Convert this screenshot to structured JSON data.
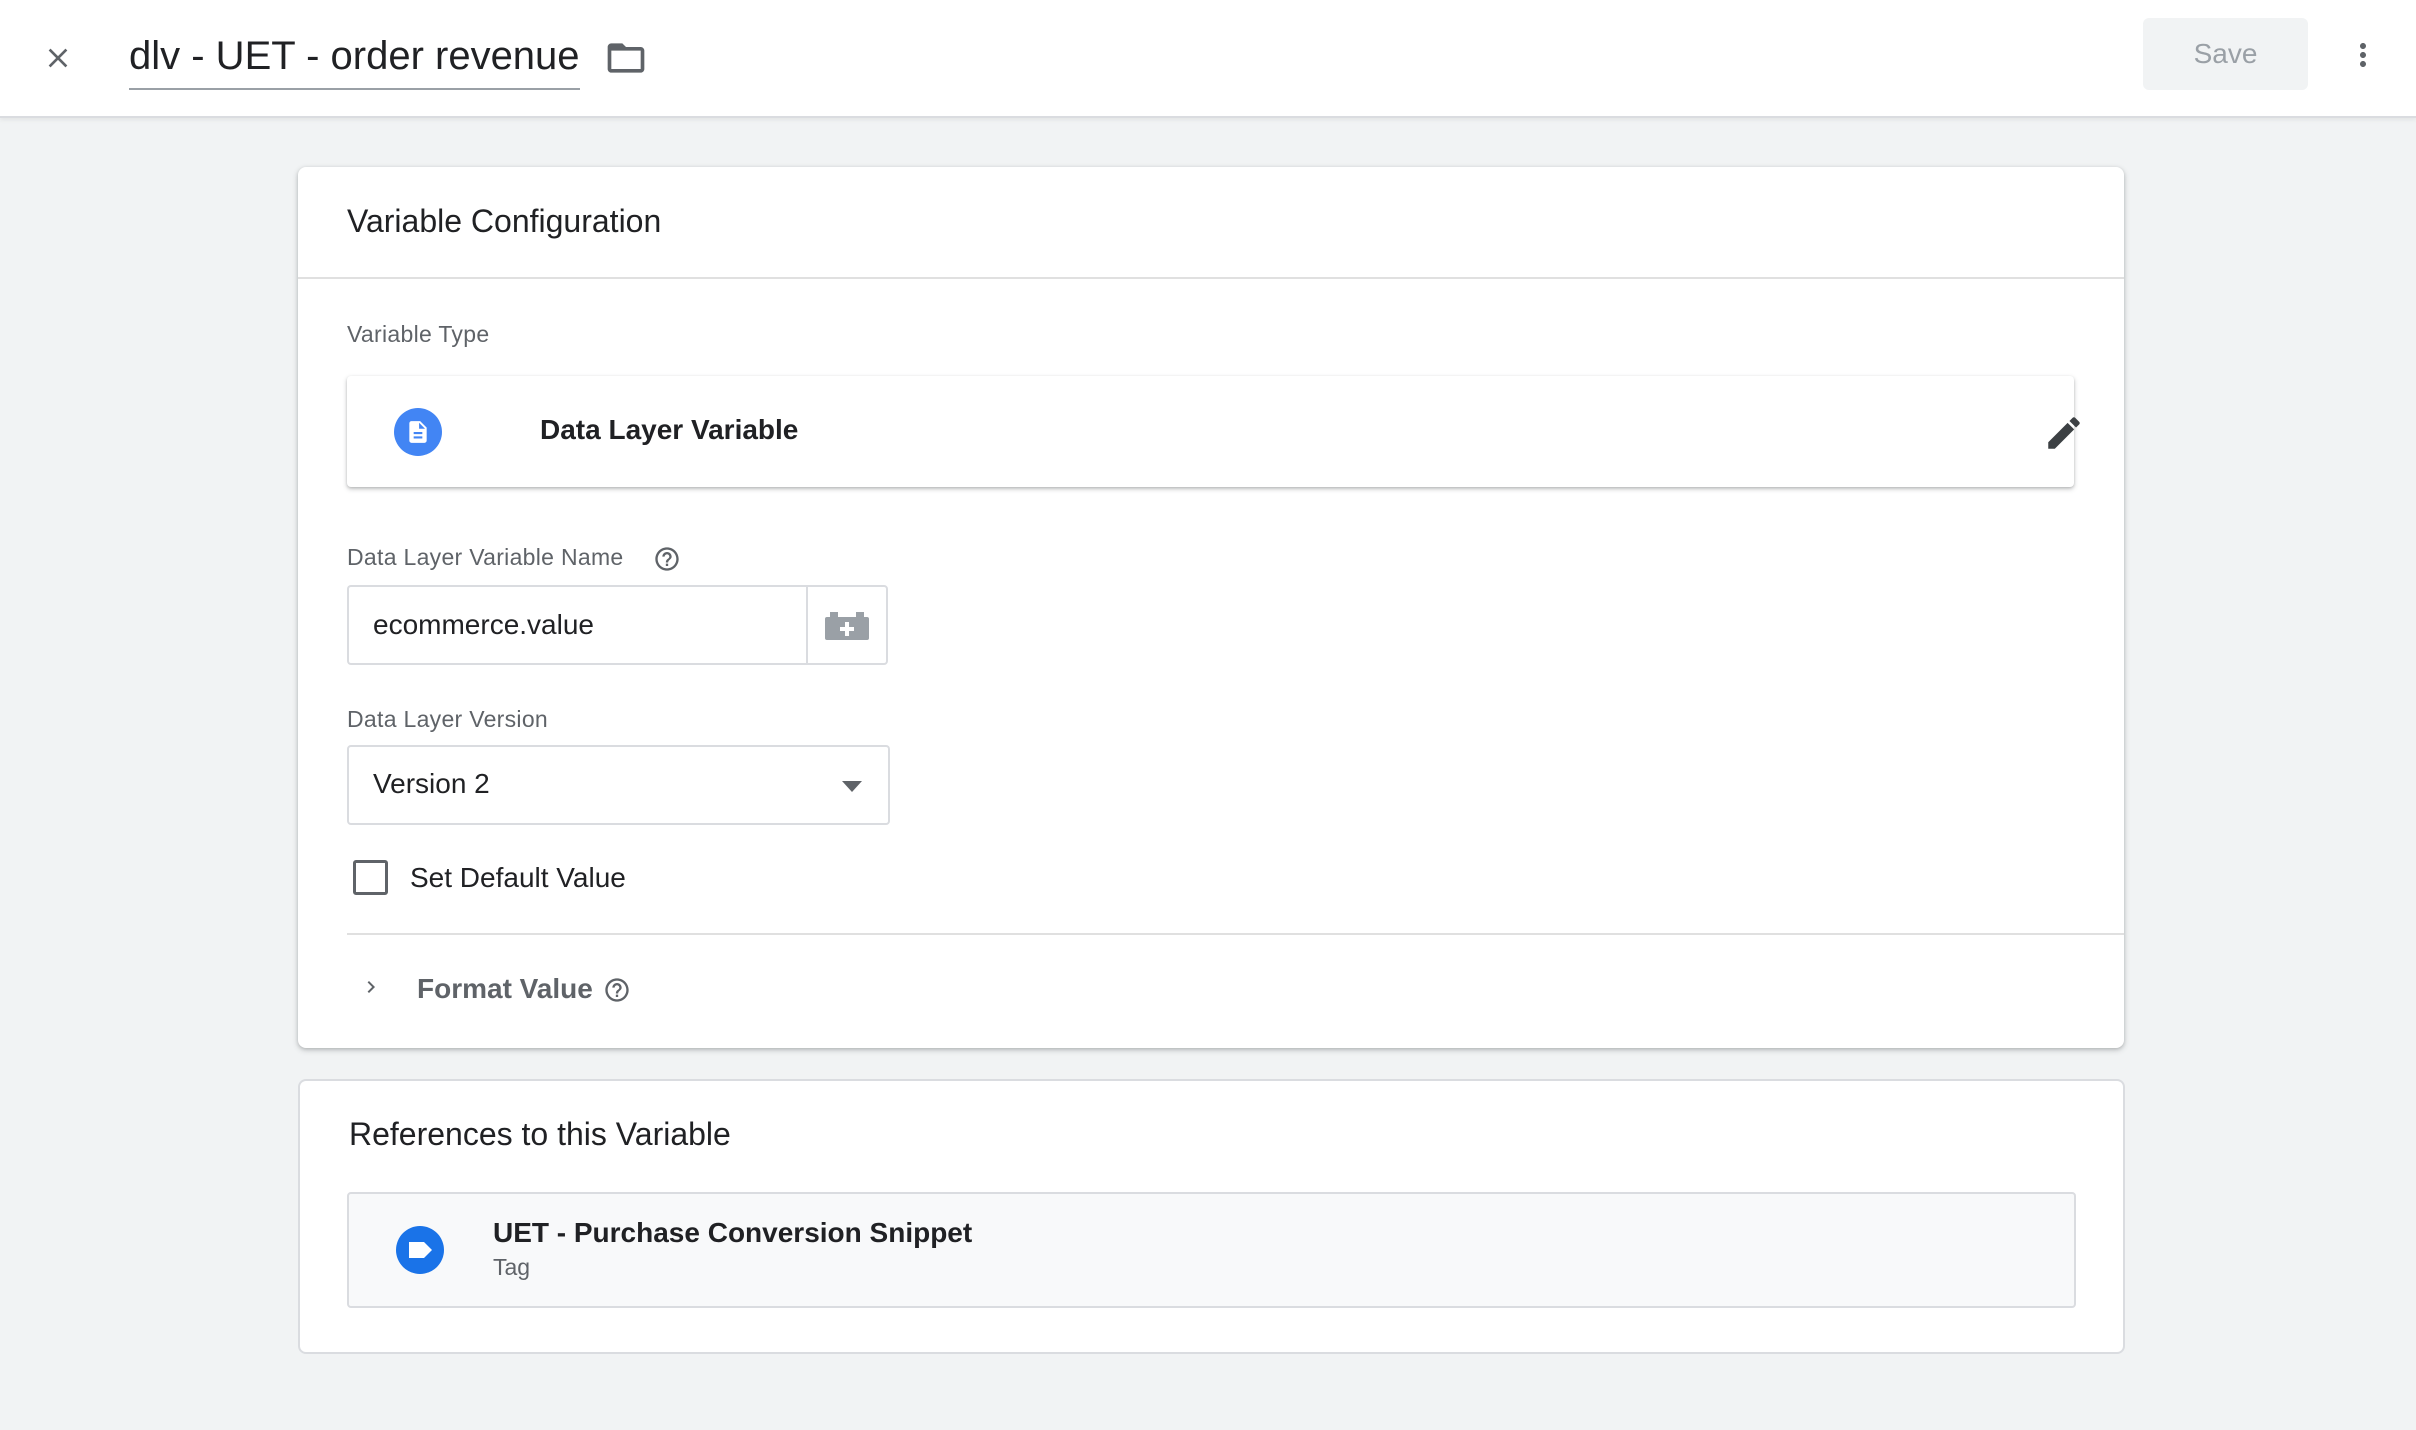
{
  "header": {
    "title": "dlv - UET - order revenue",
    "save_label": "Save",
    "close_icon": "close-icon",
    "folder_icon": "folder-icon",
    "more_icon": "more-vert-icon"
  },
  "config": {
    "card_title": "Variable Configuration",
    "variable_type_label": "Variable Type",
    "variable_type_name": "Data Layer Variable",
    "variable_type_icon": "document-icon",
    "name_label": "Data Layer Variable Name",
    "name_value": "ecommerce.value",
    "version_label": "Data Layer Version",
    "version_value": "Version 2",
    "default_value_label": "Set Default Value",
    "default_value_checked": false,
    "format_value_label": "Format Value"
  },
  "references": {
    "title": "References to this Variable",
    "items": [
      {
        "name": "UET - Purchase Conversion Snippet",
        "type": "Tag",
        "icon": "tag-icon"
      }
    ]
  },
  "colors": {
    "accent_blue": "#4285f4",
    "tag_blue": "#1a73e8",
    "background": "#f1f3f4"
  }
}
